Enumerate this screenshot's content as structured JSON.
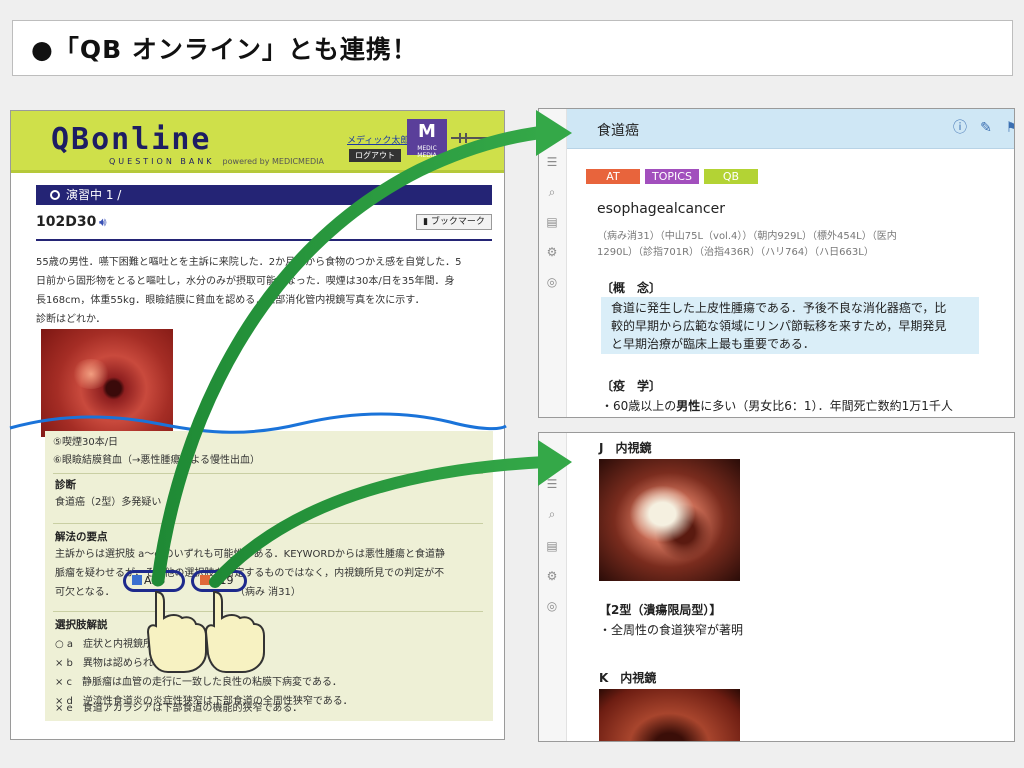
{
  "banner": {
    "title": "●「QB オンライン」とも連携！"
  },
  "qb": {
    "logo": "QBonline",
    "logo_sub": "QUESTION BANK",
    "logo_powered": "powered by MEDICMEDIA",
    "user_link": "メディック太郎",
    "logout": "ログアウト",
    "brand_badge": "MEDIC MEDIA",
    "status": "演習中 1 /",
    "question_id": "102D30",
    "bookmark": "ブックマーク",
    "stem": [
      "55歳の男性．嚥下困難と嘔吐とを主訴に来院した．2か月前から食物のつかえ感を自覚した．5",
      "日前から固形物をとると嘔吐し，水分のみが摂取可能となった．喫煙は30本/日を35年間．身",
      "長168cm，体重55kg．眼瞼結膜に貧血を認める．上部消化管内視鏡写真を次に示す．",
      "診断はどれか．"
    ],
    "options_visible": [
      "⑤喫煙30本/日",
      "⑥眼瞼結膜貧血（→悪性腫瘍による慢性出血）"
    ],
    "diagnosis_title": "診断",
    "diagnosis": "食道癌（2型）多発疑い",
    "key_title": "解法の要点",
    "key_lines": [
      "主訴からは選択肢 a～e のいずれも可能性がある．KEYWORDからは悪性腫瘍と食道静",
      "脈瘤を疑わせるが，その他の選択肢を否定するものではなく，内視鏡所見での判定が不",
      "可欠となる．"
    ],
    "ref1": "A25",
    "ref2": "A19",
    "ref_tail": "（病み 消31）",
    "choices_title": "選択肢解説",
    "choices": [
      "○ a　症状と内視鏡所見から食道癌である．",
      "× b　異物は認められない．",
      "× c　静脈瘤は血管の走行に一致した良性の粘膜下病変である．",
      "× d　逆流性食道炎の炎症性狭窄は下部食道の全周性狭窄である．",
      "× e　食道アカラシアは下部食道の機能的狭窄である．"
    ]
  },
  "panel1": {
    "title": "食道癌",
    "tags": [
      {
        "label": "AT",
        "color": "#e8643c"
      },
      {
        "label": "TOPICS",
        "color": "#a24fbd"
      },
      {
        "label": "QB",
        "color": "#b3d334"
      }
    ],
    "english": "esophagealcancer",
    "refs": [
      "（病み消31）（中山75L（vol.4））（朝内929L）（標外454L）（医内",
      "1290L）（診指701R）（治指436R）（ハリ764）（ハ日663L）"
    ],
    "concept_title": "〔概　念〕",
    "concept": [
      "食道に発生した上皮性腫瘍である．予後不良な消化器癌で，比",
      "較的早期から広範な領域にリンパ節転移を来すため，早期発見",
      "と早期治療が臨床上最も重要である．"
    ],
    "epi_title": "〔疫　学〕",
    "epi_line_pre": "・60歳以上の",
    "epi_line_bold": "男性",
    "epi_line_post": "に多い（男女比6：1）．年間死亡数約1万1千人"
  },
  "panel2": {
    "j_title": "J　内視鏡",
    "type_title": "【2型（潰瘍限局型）】",
    "type_desc": "・全周性の食道狭窄が著明",
    "k_title": "K　内視鏡"
  },
  "colors": {
    "accent_green": "#2e9a3c",
    "wave_blue": "#1a73d9",
    "qb_header": "#cfe04a",
    "qb_navy": "#242475",
    "panel_head": "#cfe7f5"
  }
}
